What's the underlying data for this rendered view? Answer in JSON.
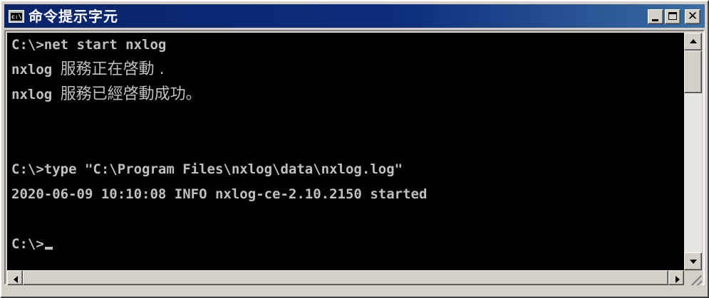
{
  "window": {
    "title": "命令提示字元",
    "icon_name": "console-icon",
    "icon_text": "c:\\"
  },
  "console": {
    "lines": [
      {
        "parts": [
          {
            "text": "C:\\>net start nxlog",
            "cjk": false
          }
        ]
      },
      {
        "parts": [
          {
            "text": "nxlog ",
            "cjk": false
          },
          {
            "text": "服務正在啓動 .",
            "cjk": true
          }
        ]
      },
      {
        "parts": [
          {
            "text": "nxlog ",
            "cjk": false
          },
          {
            "text": "服務已經啓動成功。",
            "cjk": true
          }
        ]
      },
      {
        "parts": []
      },
      {
        "parts": []
      },
      {
        "parts": [
          {
            "text": "C:\\>type \"C:\\Program Files\\nxlog\\data\\nxlog.log\"",
            "cjk": false
          }
        ]
      },
      {
        "parts": [
          {
            "text": "2020-06-09 10:10:08 INFO nxlog-ce-2.10.2150 started",
            "cjk": false
          }
        ]
      },
      {
        "parts": []
      },
      {
        "parts": [
          {
            "text": "C:\\>",
            "cjk": false
          }
        ],
        "cursor": true
      }
    ],
    "foreground": "#c0c0c0",
    "background": "#000000"
  },
  "title_buttons": {
    "minimize_icon": "minimize-icon",
    "maximize_icon": "maximize-icon",
    "close_icon": "close-icon",
    "close_glyph": "✕"
  },
  "colors": {
    "titlebar_start": "#0a246a",
    "titlebar_end": "#3a6ea5",
    "chrome": "#d4d0c8"
  }
}
